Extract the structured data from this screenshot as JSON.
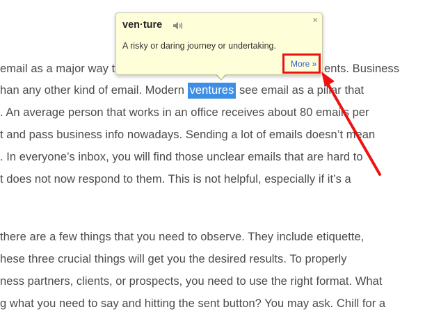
{
  "article": {
    "lines": [
      "email as a major way to",
      "han any other kind of email. Modern",
      "see email as a pillar that",
      ". An average person that works in an office receives about 80 emails per",
      "t and pass business info nowadays. Sending a lot of emails doesn’t mean",
      ". In everyone’s inbox, you will find those unclear emails that are hard to",
      "t does not now respond to them. This is not helpful, especially if it’s a",
      "there are a few things that you need to observe. They include etiquette,",
      "hese three crucial things will get you the desired results. To properly",
      "ness partners, clients, or prospects, you need to use the right format. What",
      "g what you need to say and hitting the sent button? You may ask. Chill for a"
    ],
    "line1_tail": "ents. Business",
    "highlighted_word": "ventures"
  },
  "popup": {
    "word": "ven·ture",
    "definition": "A risky or daring journey or undertaking.",
    "more_link": "More »",
    "close_label": "×",
    "speaker_icon": "speaker-icon"
  },
  "colors": {
    "highlight": "#3d8ee6",
    "popup_bg": "#fefed8",
    "annotation": "#ee1111",
    "link": "#3560c8"
  }
}
